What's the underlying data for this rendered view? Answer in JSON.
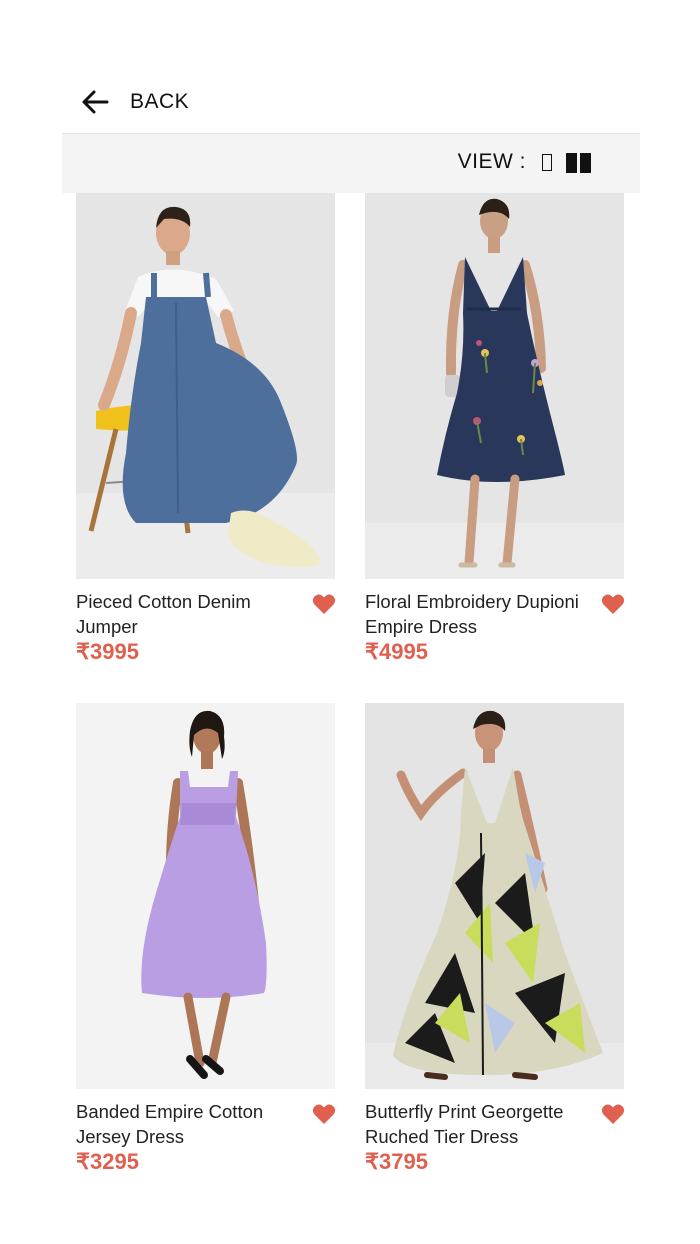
{
  "header": {
    "back_label": "BACK"
  },
  "toolbar": {
    "view_label": "VIEW :"
  },
  "colors": {
    "price": "#e0604f",
    "heart": "#e0604f",
    "viewbar_bg": "#f4f4f4"
  },
  "products": [
    {
      "name": "Pieced Cotton Denim Jumper",
      "price": "₹3995"
    },
    {
      "name": "Floral Embroidery Dupioni Empire Dress",
      "price": "₹4995"
    },
    {
      "name": "Banded Empire Cotton Jersey Dress",
      "price": "₹3295"
    },
    {
      "name": "Butterfly Print Georgette Ruched Tier Dress",
      "price": "₹3795"
    }
  ]
}
